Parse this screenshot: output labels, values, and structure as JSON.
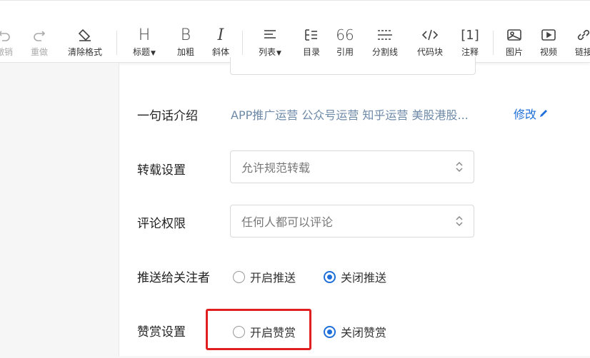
{
  "toolbar": {
    "undo": "撤销",
    "redo": "重做",
    "clear_format": "清除格式",
    "heading": "标题",
    "bold": "加粗",
    "italic": "斜体",
    "list": "列表",
    "toc": "目录",
    "quote": "引用",
    "divider": "分割线",
    "code_block": "代码块",
    "footnote": "注释",
    "image": "图片",
    "video": "视频",
    "link": "链接"
  },
  "settings": {
    "intro": {
      "label": "一句话介绍",
      "value": "APP推广运营 公众号运营 知乎运营 美股港股...",
      "edit_label": "修改"
    },
    "repost": {
      "label": "转载设置",
      "value": "允许规范转载"
    },
    "comment": {
      "label": "评论权限",
      "value": "任何人都可以评论"
    },
    "push": {
      "label": "推送给关注者",
      "option_on": "开启推送",
      "option_off": "关闭推送",
      "selected": "option_off"
    },
    "reward": {
      "label": "赞赏设置",
      "option_on": "开启赞赏",
      "option_off": "关闭赞赏",
      "selected": "option_off"
    }
  },
  "colors": {
    "accent": "#1e6fd9",
    "highlight": "#e02020",
    "intro_text": "#6e8aa8"
  }
}
